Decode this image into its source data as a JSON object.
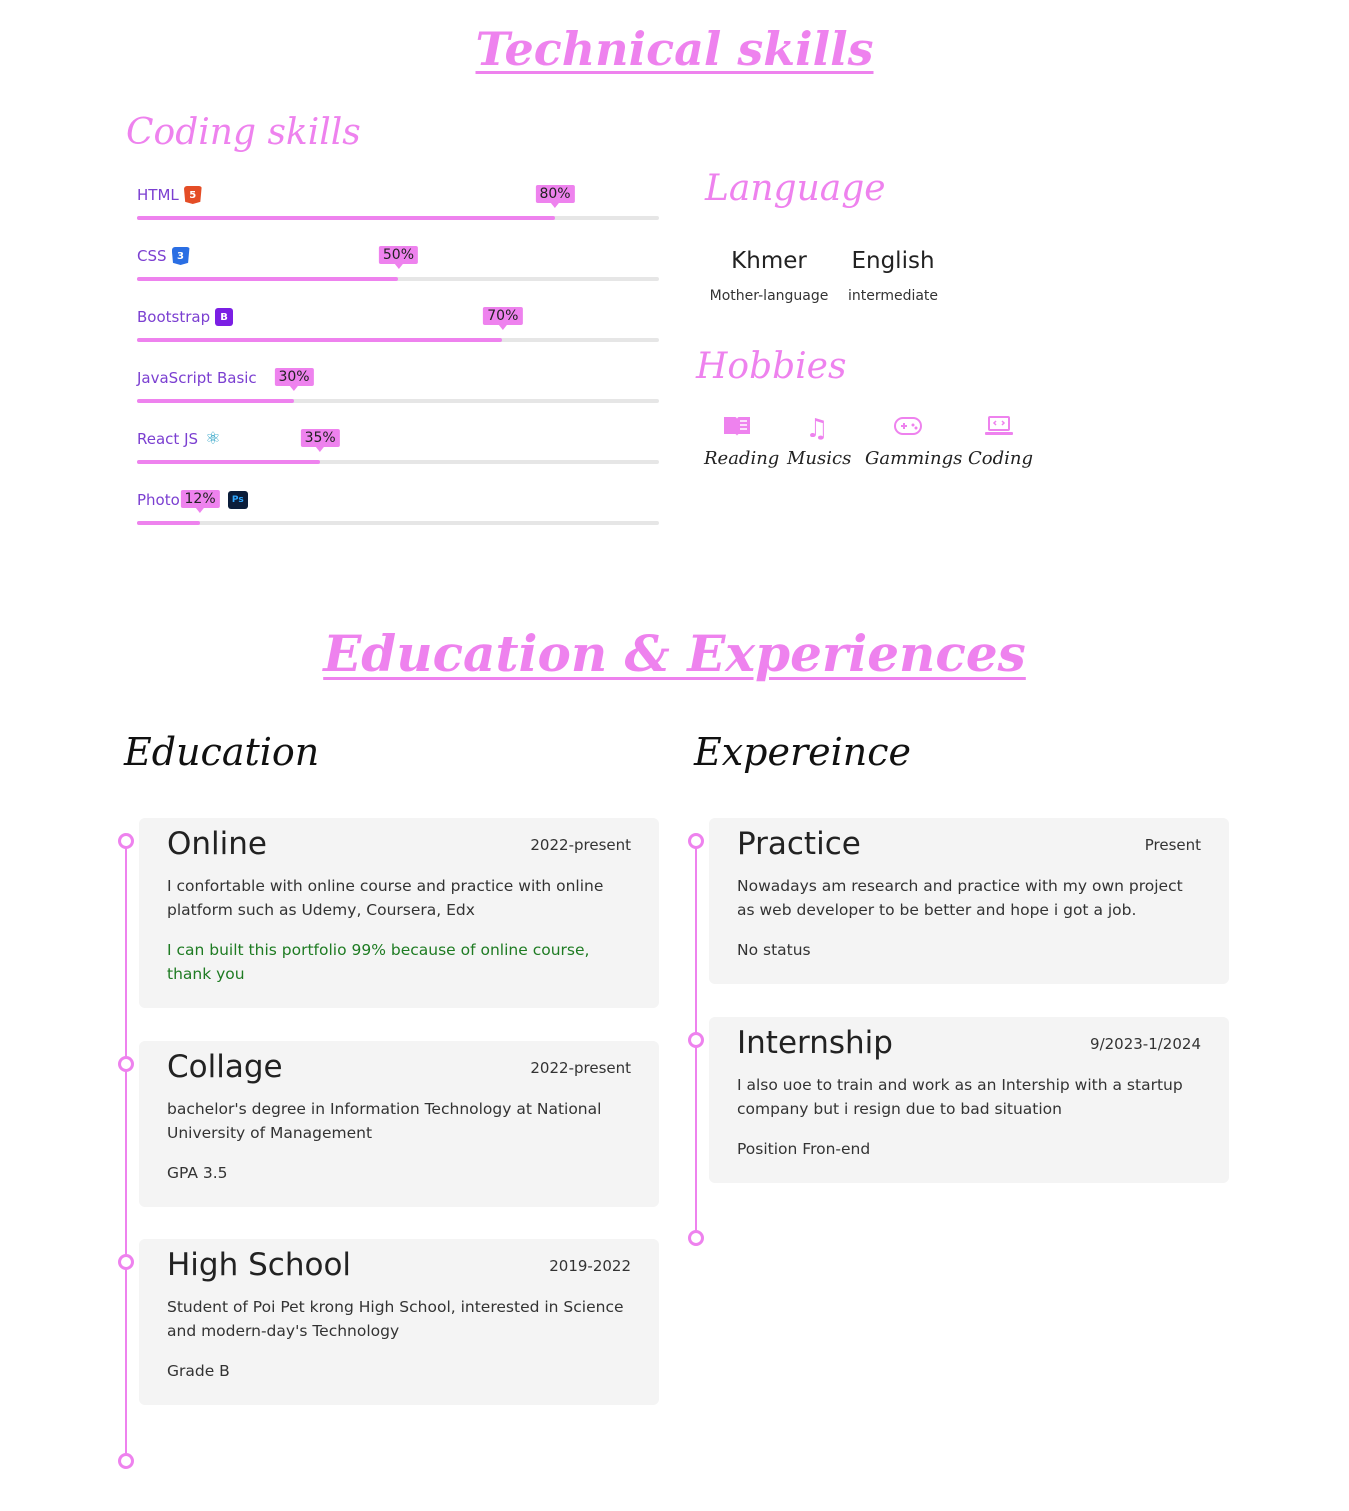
{
  "technical": {
    "title": "Technical skills",
    "coding_title": "Coding skills",
    "skills": [
      {
        "label": "HTML",
        "icon": "html5-icon",
        "percent": 80,
        "percent_label": "80%"
      },
      {
        "label": "CSS",
        "icon": "css3-icon",
        "percent": 50,
        "percent_label": "50%"
      },
      {
        "label": "Bootstrap",
        "icon": "bootstrap-icon",
        "percent": 70,
        "percent_label": "70%"
      },
      {
        "label": "JavaScript Basic",
        "icon": "",
        "percent": 30,
        "percent_label": "30%"
      },
      {
        "label": "React JS",
        "icon": "react-icon",
        "percent": 35,
        "percent_label": "35%"
      },
      {
        "label": "Photo",
        "icon": "photoshop-icon",
        "percent": 12,
        "percent_label": "12%"
      }
    ],
    "language_title": "Language",
    "languages": [
      {
        "name": "Khmer",
        "level": "Mother-language"
      },
      {
        "name": "English",
        "level": "intermediate"
      }
    ],
    "hobbies_title": "Hobbies",
    "hobbies": [
      {
        "label": "Reading",
        "icon": "book-icon"
      },
      {
        "label": "Musics",
        "icon": "music-note-icon"
      },
      {
        "label": "Gammings",
        "icon": "gamepad-icon"
      },
      {
        "label": "Coding",
        "icon": "laptop-code-icon"
      }
    ]
  },
  "education_section": {
    "title": "Education & Experiences",
    "education_title": "Education",
    "experience_title": "Expereince",
    "education": [
      {
        "title": "Online",
        "date": "2022-present",
        "desc": "I confortable with online course and practice with online platform such as Udemy, Coursera, Edx",
        "note": "I can built this portfolio 99% because of online course, thank you"
      },
      {
        "title": "Collage",
        "date": "2022-present",
        "desc": "bachelor's degree in Information Technology at National University of Management",
        "note": "GPA 3.5"
      },
      {
        "title": "High School",
        "date": "2019-2022",
        "desc": "Student of Poi Pet krong High School, interested in Science and modern-day's Technology",
        "note": "Grade B"
      }
    ],
    "experience": [
      {
        "title": "Practice",
        "date": "Present",
        "desc": "Nowadays am research and practice with my own project as web developer to be better and hope i got a job.",
        "note": "No status"
      },
      {
        "title": "Internship",
        "date": "9/2023-1/2024",
        "desc": "I also uoe to train and work as an Intership with a startup company but i resign due to bad situation",
        "note": "Position Fron-end"
      }
    ]
  },
  "colors": {
    "accent": "#ee82ee",
    "skill_label": "#7b3fd1",
    "note_green": "#1e7b22",
    "card_bg": "#f4f4f4"
  }
}
